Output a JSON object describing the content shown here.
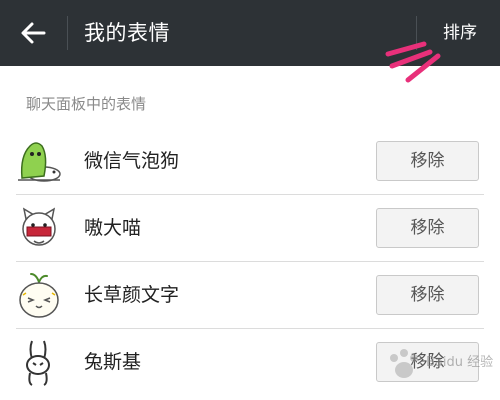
{
  "header": {
    "title": "我的表情",
    "sort_label": "排序",
    "back_icon": "arrow-left-icon"
  },
  "section": {
    "label": "聊天面板中的表情"
  },
  "stickers": [
    {
      "name": "微信气泡狗",
      "remove_label": "移除",
      "icon": "bubble-dog-sticker-icon"
    },
    {
      "name": "嗷大喵",
      "remove_label": "移除",
      "icon": "ao-da-miao-sticker-icon"
    },
    {
      "name": "长草颜文字",
      "remove_label": "移除",
      "icon": "grass-face-sticker-icon"
    },
    {
      "name": "兔斯基",
      "remove_label": "移除",
      "icon": "tuzki-sticker-icon"
    }
  ],
  "colors": {
    "header_bg": "#2d3236",
    "annotation_marks": "#e8307a"
  },
  "watermark": {
    "text": "Baidu 经验"
  }
}
